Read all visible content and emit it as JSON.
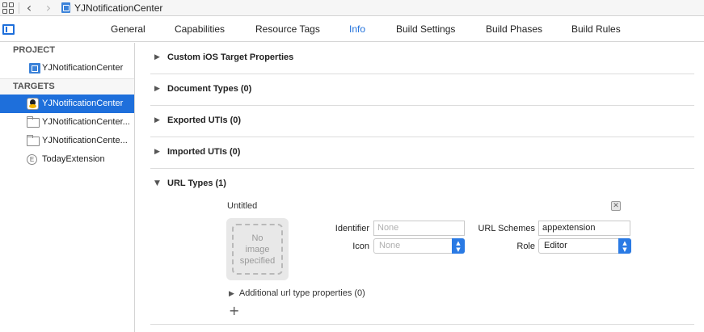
{
  "window": {
    "title": "YJNotificationCenter"
  },
  "toolbar": {
    "back_glyph": "‹",
    "forward_glyph": "›"
  },
  "tabs": [
    {
      "label": "General"
    },
    {
      "label": "Capabilities"
    },
    {
      "label": "Resource Tags"
    },
    {
      "label": "Info",
      "active": true
    },
    {
      "label": "Build Settings"
    },
    {
      "label": "Build Phases"
    },
    {
      "label": "Build Rules"
    }
  ],
  "sidebar": {
    "project_header": "PROJECT",
    "project_item": "YJNotificationCenter",
    "targets_header": "TARGETS",
    "targets": [
      {
        "label": "YJNotificationCenter",
        "icon": "app-icon",
        "selected": true
      },
      {
        "label": "YJNotificationCenter...",
        "icon": "folder-icon"
      },
      {
        "label": "YJNotificationCente...",
        "icon": "folder-icon"
      },
      {
        "label": "TodayExtension",
        "icon": "extension-icon"
      }
    ]
  },
  "sections": [
    {
      "label": "Custom iOS Target Properties"
    },
    {
      "label": "Document Types (0)"
    },
    {
      "label": "Exported UTIs (0)"
    },
    {
      "label": "Imported UTIs (0)"
    },
    {
      "label": "URL Types (1)",
      "expanded": true
    }
  ],
  "url_type": {
    "title": "Untitled",
    "image_placeholder": "No\nimage\nspecified",
    "identifier_label": "Identifier",
    "identifier_placeholder": "None",
    "icon_label": "Icon",
    "icon_placeholder": "None",
    "url_schemes_label": "URL Schemes",
    "url_schemes_value": "appextension",
    "role_label": "Role",
    "role_value": "Editor",
    "additional_label": "Additional url type properties (0)",
    "add_glyph": "+"
  },
  "colors": {
    "accent": "#1e6fdb",
    "popup_button": "#2a7ae4"
  }
}
